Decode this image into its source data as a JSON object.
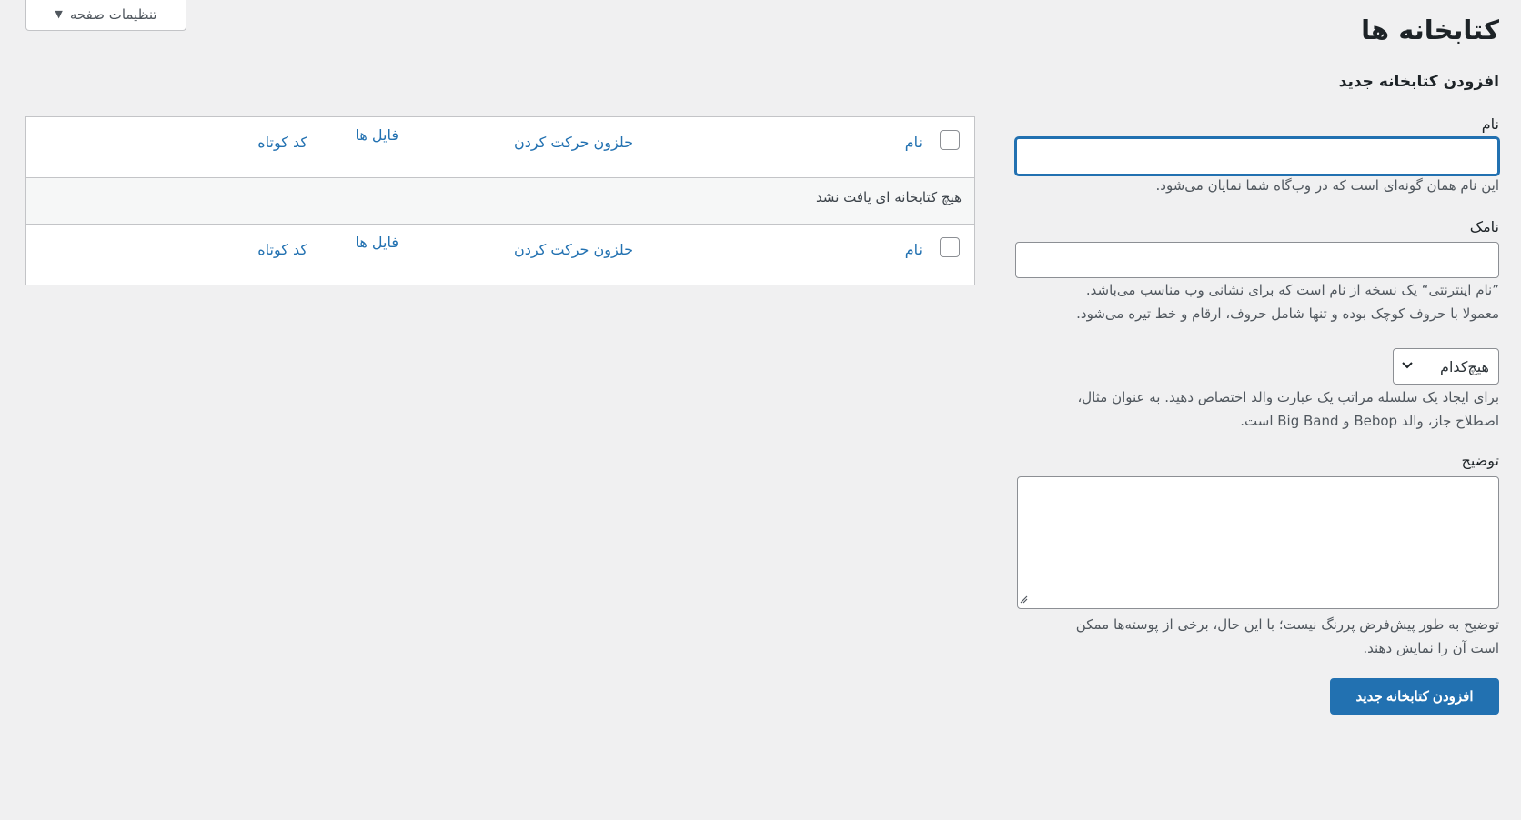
{
  "screen_options": {
    "label": "تنظیمات صفحه",
    "arrow": "▼"
  },
  "page": {
    "title": "کتابخانه ها"
  },
  "form": {
    "heading": "افزودن کتابخانه جدید",
    "name_label": "نام",
    "name_value": "",
    "name_hint": "این نام همان گونه‌ای است که در وب‌گاه شما نمایان می‌شود.",
    "slug_label": "نامک",
    "slug_value": "",
    "slug_hint_1": "”نام اینترنتی“ یک نسخه از نام است که برای نشانی وب مناسب می‌باشد.",
    "slug_hint_2": "معمولا با حروف کوچک بوده و تنها شامل حروف، ارقام و خط تیره می‌شود.",
    "parent_selected": "هیچ‌کدام",
    "parent_hint_1": "برای ایجاد یک سلسله مراتب یک عبارت والد اختصاص دهید. به عنوان مثال،",
    "parent_hint_2": "اصطلاح جاز، والد Bebop و Big Band است.",
    "desc_label": "توضیح",
    "desc_value": "",
    "desc_hint_1": "توضیح به طور پیش‌فرض پررنگ نیست؛ با این حال، برخی از پوسته‌ها ممکن",
    "desc_hint_2": "است آن را نمایش دهند.",
    "submit_label": "افزودن کتابخانه جدید"
  },
  "table": {
    "columns": {
      "name": "نام",
      "slug": "حلزون حرکت کردن",
      "files": "فایل ها",
      "shortcode": "کد کوتاه"
    },
    "empty_message": "هیچ کتابخانه ای یافت نشد"
  }
}
